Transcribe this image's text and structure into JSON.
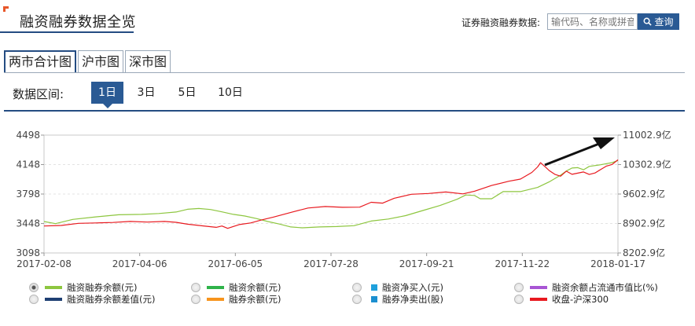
{
  "header": {
    "title": "融资融券数据全览",
    "search_label": "证券融资融券数据:",
    "search_placeholder": "输代码、名称或拼音",
    "search_button": "查询"
  },
  "tabs": [
    {
      "label": "两市合计图",
      "active": true
    },
    {
      "label": "沪市图",
      "active": false
    },
    {
      "label": "深市图",
      "active": false
    }
  ],
  "range": {
    "label": "数据区间:",
    "options": [
      {
        "label": "1日",
        "active": true
      },
      {
        "label": "3日",
        "active": false
      },
      {
        "label": "5日",
        "active": false
      },
      {
        "label": "10日",
        "active": false
      }
    ]
  },
  "chart_data": {
    "type": "line",
    "x_ticks": [
      "2017-02-08",
      "2017-04-06",
      "2017-06-05",
      "2017-07-28",
      "2017-09-21",
      "2017-11-22",
      "2018-01-17"
    ],
    "left_axis": {
      "ticks": [
        "4498",
        "4148",
        "3798",
        "3448",
        "3098"
      ],
      "range": [
        3098,
        4498
      ]
    },
    "right_axis": {
      "ticks": [
        "11002.9亿",
        "10302.9亿",
        "9602.9亿",
        "8902.9亿",
        "8202.9亿"
      ],
      "range": [
        8202.9,
        11002.9
      ]
    },
    "grid": true,
    "series": [
      {
        "name": "融资融券余额(元)",
        "color": "#8dc63f",
        "axis": "right",
        "points": [
          [
            0,
            8950
          ],
          [
            0.02,
            8900
          ],
          [
            0.05,
            9000
          ],
          [
            0.09,
            9060
          ],
          [
            0.13,
            9110
          ],
          [
            0.17,
            9120
          ],
          [
            0.2,
            9140
          ],
          [
            0.23,
            9175
          ],
          [
            0.25,
            9240
          ],
          [
            0.27,
            9260
          ],
          [
            0.29,
            9235
          ],
          [
            0.31,
            9180
          ],
          [
            0.33,
            9120
          ],
          [
            0.35,
            9080
          ],
          [
            0.37,
            9020
          ],
          [
            0.39,
            8950
          ],
          [
            0.41,
            8890
          ],
          [
            0.43,
            8820
          ],
          [
            0.45,
            8800
          ],
          [
            0.48,
            8820
          ],
          [
            0.51,
            8830
          ],
          [
            0.54,
            8850
          ],
          [
            0.57,
            8960
          ],
          [
            0.6,
            9010
          ],
          [
            0.63,
            9090
          ],
          [
            0.66,
            9210
          ],
          [
            0.69,
            9330
          ],
          [
            0.72,
            9480
          ],
          [
            0.735,
            9580
          ],
          [
            0.75,
            9570
          ],
          [
            0.76,
            9490
          ],
          [
            0.78,
            9490
          ],
          [
            0.8,
            9660
          ],
          [
            0.83,
            9660
          ],
          [
            0.86,
            9760
          ],
          [
            0.88,
            9890
          ],
          [
            0.9,
            10050
          ],
          [
            0.91,
            10150
          ],
          [
            0.92,
            10220
          ],
          [
            0.93,
            10230
          ],
          [
            0.94,
            10180
          ],
          [
            0.95,
            10260
          ],
          [
            0.97,
            10300
          ],
          [
            0.99,
            10350
          ],
          [
            1,
            10400
          ]
        ]
      },
      {
        "name": "收盘-沪深300",
        "color": "#e8191f",
        "axis": "left",
        "points": [
          [
            0,
            3418
          ],
          [
            0.03,
            3425
          ],
          [
            0.06,
            3450
          ],
          [
            0.09,
            3455
          ],
          [
            0.12,
            3460
          ],
          [
            0.15,
            3472
          ],
          [
            0.18,
            3465
          ],
          [
            0.21,
            3472
          ],
          [
            0.23,
            3462
          ],
          [
            0.25,
            3440
          ],
          [
            0.27,
            3425
          ],
          [
            0.3,
            3402
          ],
          [
            0.31,
            3418
          ],
          [
            0.32,
            3390
          ],
          [
            0.34,
            3435
          ],
          [
            0.36,
            3455
          ],
          [
            0.38,
            3492
          ],
          [
            0.4,
            3525
          ],
          [
            0.43,
            3580
          ],
          [
            0.46,
            3632
          ],
          [
            0.49,
            3650
          ],
          [
            0.52,
            3640
          ],
          [
            0.55,
            3642
          ],
          [
            0.57,
            3700
          ],
          [
            0.59,
            3690
          ],
          [
            0.61,
            3748
          ],
          [
            0.64,
            3795
          ],
          [
            0.67,
            3805
          ],
          [
            0.7,
            3822
          ],
          [
            0.73,
            3800
          ],
          [
            0.75,
            3832
          ],
          [
            0.78,
            3900
          ],
          [
            0.81,
            3950
          ],
          [
            0.83,
            3975
          ],
          [
            0.85,
            4055
          ],
          [
            0.86,
            4120
          ],
          [
            0.865,
            4170
          ],
          [
            0.875,
            4110
          ],
          [
            0.88,
            4078
          ],
          [
            0.89,
            4032
          ],
          [
            0.9,
            4010
          ],
          [
            0.91,
            4070
          ],
          [
            0.92,
            4032
          ],
          [
            0.94,
            4060
          ],
          [
            0.95,
            4030
          ],
          [
            0.96,
            4048
          ],
          [
            0.97,
            4090
          ],
          [
            0.98,
            4130
          ],
          [
            0.99,
            4150
          ],
          [
            1,
            4205
          ]
        ]
      }
    ]
  },
  "legend": [
    {
      "label": "融资融券余额(元)",
      "color": "#8dc63f",
      "checked": true
    },
    {
      "label": "融资余额(元)",
      "color": "#2fb34a",
      "checked": false
    },
    {
      "label": "融资净买入(元)",
      "color": "#1fa0dc",
      "checked": false
    },
    {
      "label": "融资余额占流通市值比(%)",
      "color": "#a855d4",
      "checked": false
    },
    {
      "label": "融资融券余额差值(元)",
      "color": "#1e3f73",
      "checked": false
    },
    {
      "label": "融券余额(元)",
      "color": "#f7941d",
      "checked": false
    },
    {
      "label": "融券净卖出(股)",
      "color": "#1b8fd0",
      "checked": false
    },
    {
      "label": "收盘-沪深300",
      "color": "#e8191f",
      "checked": false
    }
  ]
}
